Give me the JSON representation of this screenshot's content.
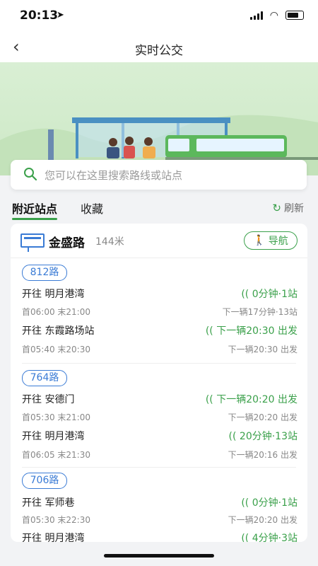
{
  "status_bar": {
    "time": "20:13",
    "location_icon": "location-arrow-icon",
    "signal_icon": "signal-icon",
    "wifi_icon": "wifi-icon",
    "battery_icon": "battery-icon"
  },
  "header": {
    "back_icon": "back-chevron-icon",
    "title": "实时公交"
  },
  "search": {
    "placeholder": "您可以在这里搜索路线或站点"
  },
  "tabs": [
    {
      "label": "附近站点",
      "active": true
    },
    {
      "label": "收藏",
      "active": false
    }
  ],
  "refresh_label": "刷新",
  "stop": {
    "name": "金盛路",
    "distance": "144米",
    "nav_label": "导航"
  },
  "routes": [
    {
      "number": "812路",
      "directions": [
        {
          "dest": "开往 明月港湾",
          "hours": "首06:00 末21:00",
          "eta": "0分钟·1站",
          "next": "下一辆17分钟·13站"
        },
        {
          "dest": "开往 东霞路场站",
          "hours": "首05:40 末20:30",
          "eta": "下一辆20:30 出发",
          "next": "下一辆20:30 出发"
        }
      ]
    },
    {
      "number": "764路",
      "directions": [
        {
          "dest": "开往 安德门",
          "hours": "首05:30 末21:00",
          "eta": "下一辆20:20 出发",
          "next": "下一辆20:20 出发"
        },
        {
          "dest": "开往 明月港湾",
          "hours": "首06:05 末21:30",
          "eta": "20分钟·13站",
          "next": "下一辆20:16 出发"
        }
      ]
    },
    {
      "number": "706路",
      "directions": [
        {
          "dest": "开往 军师巷",
          "hours": "首05:30 末22:30",
          "eta": "0分钟·1站",
          "next": "下一辆20:20 出发"
        },
        {
          "dest": "开往 明月港湾",
          "hours": "",
          "eta": "4分钟·3站",
          "next": ""
        }
      ]
    }
  ],
  "colors": {
    "accent": "#3aa04a",
    "route_blue": "#3a7bd5",
    "hero_bg": "#d9efd4"
  }
}
